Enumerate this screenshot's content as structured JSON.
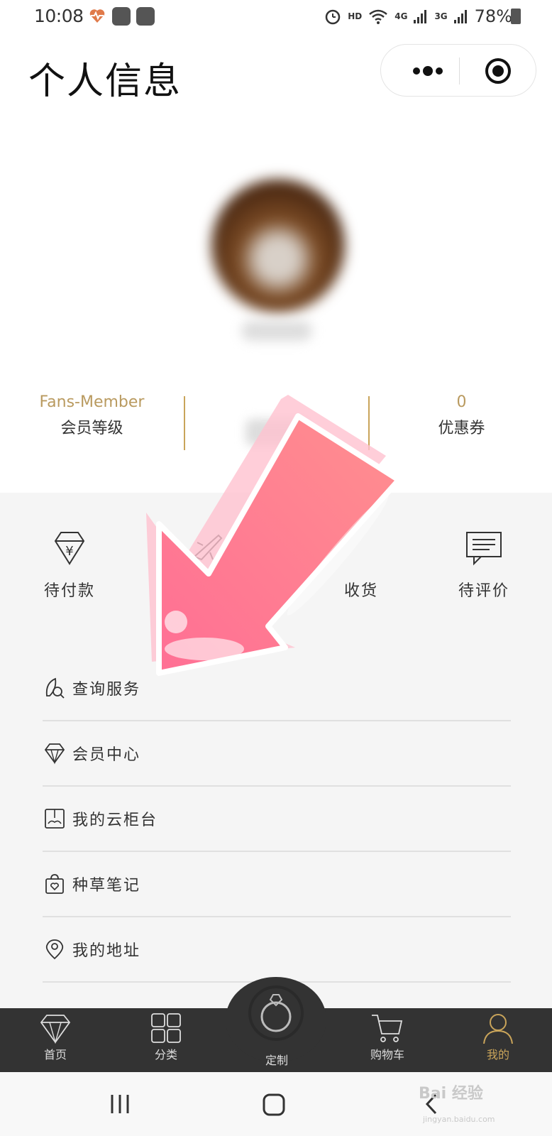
{
  "status_bar": {
    "time": "10:08",
    "hd": "HD",
    "net1": "4G",
    "net2": "3G",
    "battery": "78%"
  },
  "header": {
    "title": "个人信息",
    "capsule_icons": [
      "more-dots-icon",
      "target-icon"
    ]
  },
  "stats": [
    {
      "value": "Fans-Member",
      "label": "会员等级"
    },
    {
      "value": "",
      "label": ""
    },
    {
      "value": "0",
      "label": "优惠券"
    }
  ],
  "orders": [
    {
      "label": "待付款",
      "icon": "diamond-yen-icon"
    },
    {
      "label": "",
      "icon": "airplane-icon"
    },
    {
      "label": "收货",
      "icon": "package-icon"
    },
    {
      "label": "待评价",
      "icon": "comment-icon"
    }
  ],
  "menu": [
    {
      "label": "查询服务",
      "icon": "leaf-search-icon"
    },
    {
      "label": "会员中心",
      "icon": "diamond-icon"
    },
    {
      "label": "我的云柜台",
      "icon": "counter-icon"
    },
    {
      "label": "种草笔记",
      "icon": "heart-bag-icon"
    },
    {
      "label": "我的地址",
      "icon": "location-pin-icon"
    }
  ],
  "tabbar": [
    {
      "label": "首页",
      "icon": "diamond-icon",
      "active": false
    },
    {
      "label": "分类",
      "icon": "category-grid-icon",
      "active": false
    },
    {
      "label": "定制",
      "icon": "ring-icon",
      "active": false
    },
    {
      "label": "购物车",
      "icon": "cart-icon",
      "active": false
    },
    {
      "label": "我的",
      "icon": "person-icon",
      "active": true
    }
  ],
  "colors": {
    "accent_gold": "#c9a45a",
    "tabbar_bg": "#333333",
    "grey_bg": "#f5f5f5",
    "arrow_pink": "#ff7f97"
  },
  "watermark": {
    "brand": "Bai 经验",
    "url": "jingyan.baidu.com"
  }
}
